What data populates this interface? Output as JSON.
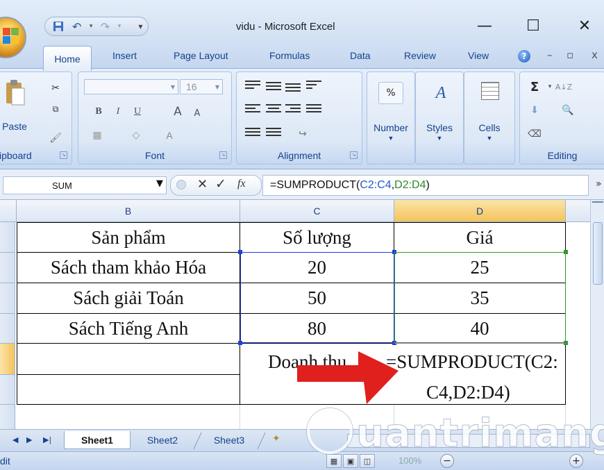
{
  "window": {
    "title": "vidu - Microsoft Excel",
    "minimize": "—",
    "maximize": "☐",
    "close": "✕"
  },
  "qat": {
    "save": "💾",
    "undo": "↶",
    "undo_arrow": "▾",
    "redo": "↷",
    "redo_arrow": "▾",
    "customize": "₹"
  },
  "tabs": [
    "Home",
    "Insert",
    "Page Layout",
    "Formulas",
    "Data",
    "Review",
    "View"
  ],
  "ribbon_win": {
    "minimize": "–",
    "restore": "▫",
    "close": "x"
  },
  "ribbon": {
    "clipboard": {
      "label": "ipboard",
      "paste": "Paste"
    },
    "font": {
      "label": "Font",
      "size": "16",
      "bold": "B",
      "italic": "I",
      "underline": "U",
      "grow": "A",
      "shrink": "A"
    },
    "alignment": {
      "label": "Alignment"
    },
    "number": {
      "label": "Number",
      "icon": "%"
    },
    "styles": {
      "label": "Styles"
    },
    "cells": {
      "label": "Cells"
    },
    "editing": {
      "label": "Editing",
      "sum": "Σ",
      "sort": "A↓Z",
      "find": "🔭"
    }
  },
  "formula_bar": {
    "name_box": "SUM",
    "formula_prefix": "=SUMPRODUCT(",
    "ref1": "C2:C4",
    "comma": ",",
    "ref2": "D2:D4",
    "formula_suffix": ")",
    "fx": "fx"
  },
  "columns": [
    "B",
    "C",
    "D"
  ],
  "table": {
    "headers": [
      "Sản phẩm",
      "Số lượng",
      "Giá"
    ],
    "rows": [
      [
        "Sách tham khảo Hóa",
        "20",
        "25"
      ],
      [
        "Sách giải Toán",
        "50",
        "35"
      ],
      [
        "Sách Tiếng Anh",
        "80",
        "40"
      ]
    ],
    "revenue_label": "Doanh thu",
    "formula_line1": "=SUMPRODUCT(C2:",
    "formula_line2": "C4,D2:D4)"
  },
  "sheets": [
    "Sheet1",
    "Sheet2",
    "Sheet3"
  ],
  "status": {
    "mode": "dit",
    "zoom": "100%"
  },
  "watermark": "uantrimang"
}
